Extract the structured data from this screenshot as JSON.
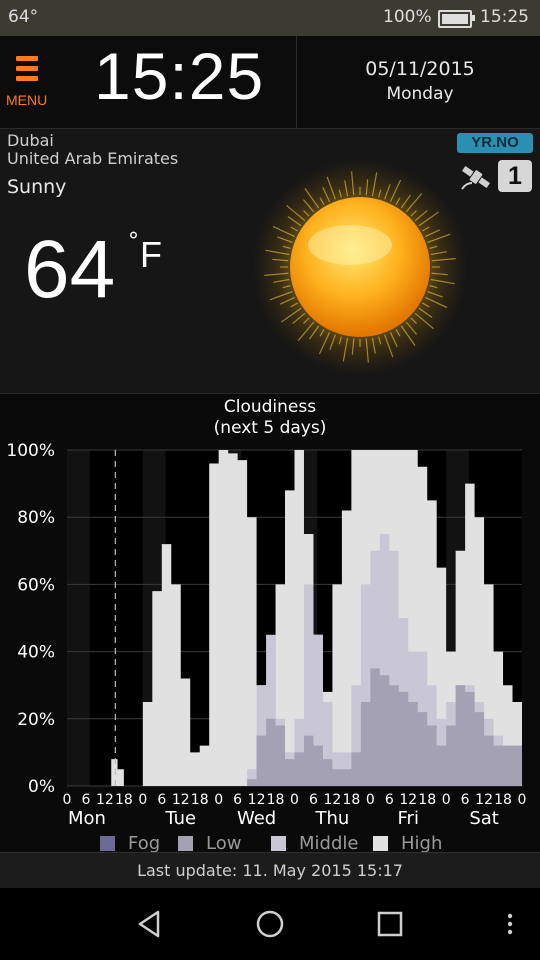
{
  "status_bar": {
    "temperature": "64°",
    "battery": "100%",
    "time": "15:25"
  },
  "header": {
    "menu_label": "MENU",
    "clock": "15:25",
    "date": "05/11/2015",
    "weekday": "Monday"
  },
  "weather": {
    "city": "Dubai",
    "country": "United Arab Emirates",
    "condition": "Sunny",
    "temperature": "64",
    "degree_symbol": "°",
    "unit": "F",
    "provider_logo": "YR.NO",
    "source_badge": "1",
    "icons": {
      "condition_icon": "sun-icon",
      "source_icon": "satellite-icon"
    }
  },
  "chart_data": {
    "type": "area",
    "title": "Cloudiness",
    "subtitle": "(next 5 days)",
    "y_tick_labels": [
      "0%",
      "20%",
      "40%",
      "60%",
      "80%",
      "100%"
    ],
    "ylim": [
      0,
      100
    ],
    "x_hour_ticks": [
      "0",
      "6",
      "12",
      "18",
      "0",
      "6",
      "12",
      "18",
      "0",
      "6",
      "12",
      "18",
      "0",
      "6",
      "12",
      "18",
      "0",
      "6",
      "12",
      "18",
      "0",
      "6",
      "12",
      "18",
      "0"
    ],
    "day_labels": [
      "Mon",
      "Tue",
      "Wed",
      "Thu",
      "Fri",
      "Sat"
    ],
    "legend": [
      {
        "name": "Fog",
        "color": "#6e6a96"
      },
      {
        "name": "Low",
        "color": "#a4a1b4"
      },
      {
        "name": "Middle",
        "color": "#c9c7d5"
      },
      {
        "name": "High",
        "color": "#e1e1e1"
      }
    ],
    "x_hours": [
      0,
      6,
      12,
      14,
      16,
      18,
      21,
      24,
      27,
      30,
      33,
      36,
      39,
      42,
      45,
      48,
      51,
      54,
      57,
      60,
      63,
      66,
      69,
      72,
      75,
      78,
      81,
      84,
      87,
      90,
      93,
      96,
      99,
      102,
      105,
      108,
      111,
      114,
      117,
      120,
      123,
      126,
      129,
      132,
      135,
      138,
      141,
      144
    ],
    "series": [
      {
        "name": "High",
        "values": [
          0,
          0,
          0,
          8,
          5,
          0,
          0,
          25,
          58,
          72,
          60,
          32,
          10,
          12,
          96,
          100,
          99,
          97,
          80,
          30,
          18,
          60,
          88,
          100,
          75,
          45,
          28,
          60,
          82,
          100,
          100,
          100,
          100,
          100,
          100,
          100,
          95,
          85,
          65,
          40,
          70,
          90,
          80,
          60,
          40,
          30,
          25,
          25
        ]
      },
      {
        "name": "Middle",
        "values": [
          0,
          0,
          0,
          0,
          0,
          0,
          0,
          0,
          0,
          0,
          0,
          0,
          0,
          0,
          0,
          0,
          0,
          0,
          5,
          30,
          45,
          20,
          10,
          20,
          60,
          45,
          25,
          10,
          10,
          30,
          60,
          70,
          75,
          70,
          50,
          40,
          40,
          30,
          20,
          25,
          30,
          30,
          25,
          20,
          15,
          12,
          12,
          12
        ]
      },
      {
        "name": "Low",
        "values": [
          0,
          0,
          0,
          0,
          0,
          0,
          0,
          0,
          0,
          0,
          0,
          0,
          0,
          0,
          0,
          0,
          0,
          0,
          2,
          15,
          20,
          18,
          8,
          10,
          15,
          12,
          8,
          5,
          5,
          10,
          25,
          35,
          33,
          30,
          28,
          25,
          22,
          18,
          12,
          18,
          30,
          28,
          22,
          15,
          12,
          12,
          12,
          12
        ]
      },
      {
        "name": "Fog",
        "values": [
          0,
          0,
          0,
          0,
          0,
          0,
          0,
          0,
          0,
          0,
          0,
          0,
          0,
          0,
          0,
          0,
          0,
          0,
          0,
          0,
          0,
          0,
          0,
          0,
          0,
          0,
          0,
          0,
          0,
          0,
          0,
          0,
          0,
          0,
          0,
          0,
          0,
          0,
          0,
          0,
          0,
          0,
          0,
          0,
          0,
          0,
          0,
          0
        ]
      }
    ],
    "now_marker_hour": 15.3
  },
  "footer": {
    "last_update": "Last update: 11. May 2015  15:17"
  },
  "navbar": {
    "icons": [
      "back-icon",
      "home-icon",
      "recents-icon",
      "more-icon"
    ]
  }
}
